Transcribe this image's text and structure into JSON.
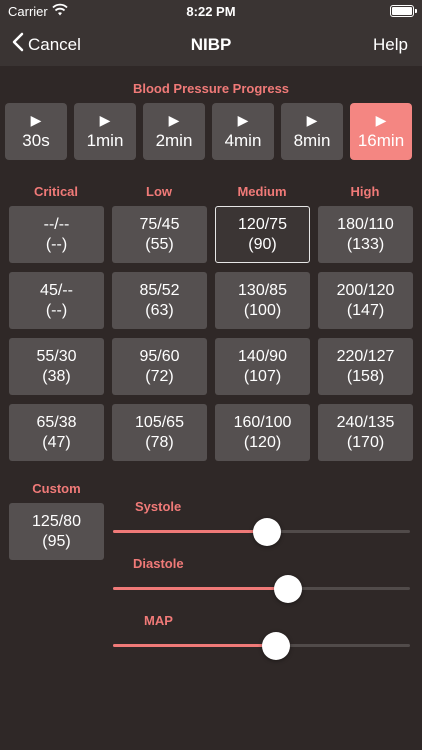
{
  "status": {
    "carrier": "Carrier",
    "time": "8:22 PM"
  },
  "nav": {
    "cancel": "Cancel",
    "title": "NIBP",
    "help": "Help"
  },
  "progress": {
    "title": "Blood Pressure Progress",
    "buttons": [
      {
        "label": "30s",
        "active": false
      },
      {
        "label": "1min",
        "active": false
      },
      {
        "label": "2min",
        "active": false
      },
      {
        "label": "4min",
        "active": false
      },
      {
        "label": "8min",
        "active": false
      },
      {
        "label": "16min",
        "active": true
      }
    ]
  },
  "categories": [
    "Critical",
    "Low",
    "Medium",
    "High"
  ],
  "presets": [
    [
      {
        "bp": "--/--",
        "map": "(--)"
      },
      {
        "bp": "75/45",
        "map": "(55)"
      },
      {
        "bp": "120/75",
        "map": "(90)",
        "selected": true
      },
      {
        "bp": "180/110",
        "map": "(133)"
      }
    ],
    [
      {
        "bp": "45/--",
        "map": "(--)"
      },
      {
        "bp": "85/52",
        "map": "(63)"
      },
      {
        "bp": "130/85",
        "map": "(100)"
      },
      {
        "bp": "200/120",
        "map": "(147)"
      }
    ],
    [
      {
        "bp": "55/30",
        "map": "(38)"
      },
      {
        "bp": "95/60",
        "map": "(72)"
      },
      {
        "bp": "140/90",
        "map": "(107)"
      },
      {
        "bp": "220/127",
        "map": "(158)"
      }
    ],
    [
      {
        "bp": "65/38",
        "map": "(47)"
      },
      {
        "bp": "105/65",
        "map": "(78)"
      },
      {
        "bp": "160/100",
        "map": "(120)"
      },
      {
        "bp": "240/135",
        "map": "(170)"
      }
    ]
  ],
  "custom": {
    "label": "Custom",
    "bp": "125/80",
    "map": "(95)"
  },
  "sliders": [
    {
      "label": "Systole",
      "value": 0.52
    },
    {
      "label": "Diastole",
      "value": 0.59
    },
    {
      "label": "MAP",
      "value": 0.55
    }
  ],
  "colors": {
    "accent": "#f07a78",
    "active_button": "#f48682",
    "background": "#2f2827",
    "cell": "#555050"
  }
}
